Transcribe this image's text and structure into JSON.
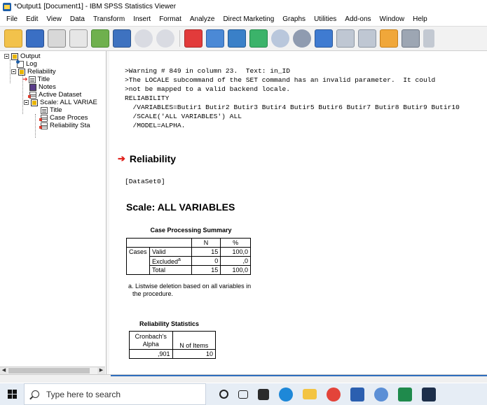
{
  "window": {
    "title": "*Output1 [Document1] - IBM SPSS Statistics Viewer"
  },
  "menu": [
    "File",
    "Edit",
    "View",
    "Data",
    "Transform",
    "Insert",
    "Format",
    "Analyze",
    "Direct Marketing",
    "Graphs",
    "Utilities",
    "Add-ons",
    "Window",
    "Help"
  ],
  "toolbar": [
    "open-icon",
    "save-icon",
    "print-icon",
    "print-preview-icon",
    "export-icon",
    "recall-dialog-icon",
    "undo-icon",
    "redo-icon",
    "goto-data-icon",
    "goto-case-icon",
    "goto-variable-icon",
    "variables-icon",
    "show-all-icon",
    "designate-window-icon",
    "insert-output-icon",
    "promote-icon",
    "demote-icon",
    "collapse-icon",
    "expand-icon",
    "show-icon",
    "hide-icon",
    "back-icon"
  ],
  "outline": {
    "output": "Output",
    "log": "Log",
    "reliability": "Reliability",
    "title": "Title",
    "notes": "Notes",
    "active_dataset": "Active Dataset",
    "scale": "Scale: ALL VARIAE",
    "scale_title": "Title",
    "case_processing": "Case Proces",
    "reliability_stats": "Reliability Sta"
  },
  "log": {
    "lines": [
      ">Warning # 849 in column 23.  Text: in_ID",
      ">The LOCALE subcommand of the SET command has an invalid parameter.  It could",
      ">not be mapped to a valid backend locale.",
      "RELIABILITY",
      "  /VARIABLES=Butir1 Butir2 Butir3 Butir4 Butir5 Butir6 Butir7 Butir8 Butir9 Butir10",
      "  /SCALE('ALL VARIABLES') ALL",
      "  /MODEL=ALPHA."
    ]
  },
  "output": {
    "heading": "Reliability",
    "dataset": "[DataSet0]",
    "scale_heading": "Scale: ALL VARIABLES",
    "case_summary": {
      "title": "Case Processing Summary",
      "col_n": "N",
      "col_pct": "%",
      "group": "Cases",
      "rows": [
        {
          "label": "Valid",
          "n": "15",
          "pct": "100,0"
        },
        {
          "label": "Excluded",
          "sup": "a",
          "n": "0",
          "pct": ",0"
        },
        {
          "label": "Total",
          "n": "15",
          "pct": "100,0"
        }
      ],
      "footnote_1": "a. Listwise deletion based on all variables in",
      "footnote_2": "the procedure."
    },
    "reliability_stats": {
      "title": "Reliability Statistics",
      "col_alpha_1": "Cronbach's",
      "col_alpha_2": "Alpha",
      "col_items": "N of Items",
      "alpha": ",901",
      "items": "10"
    }
  },
  "taskbar": {
    "search_placeholder": "Type here to search"
  }
}
